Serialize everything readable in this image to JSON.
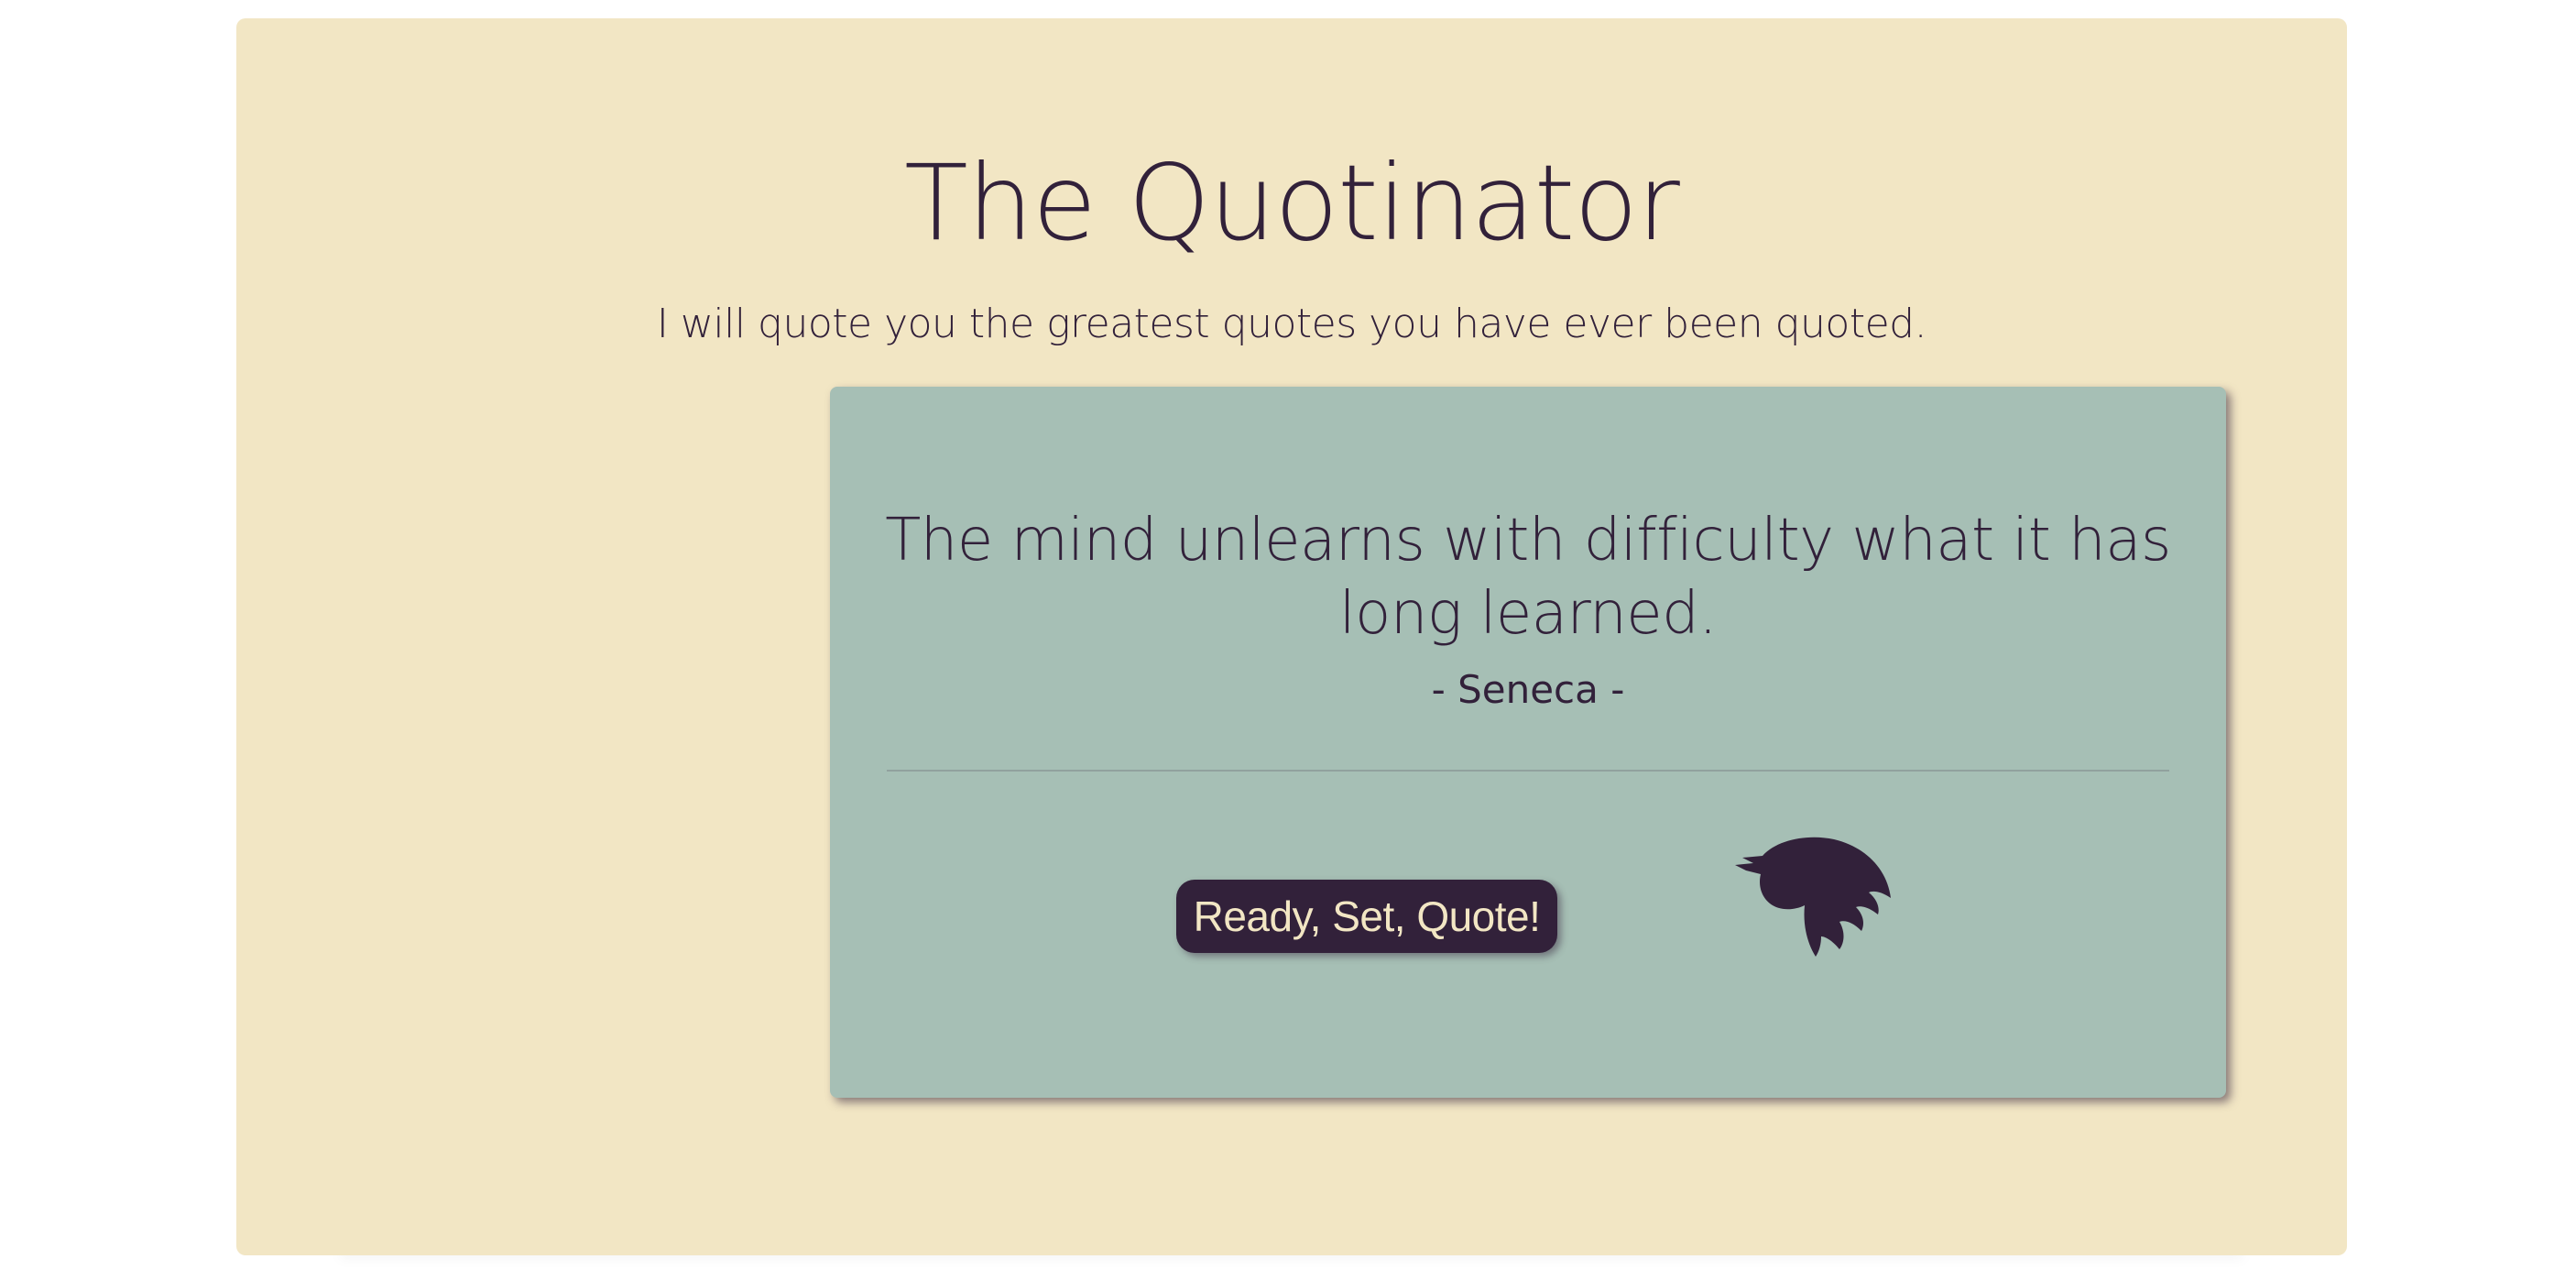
{
  "header": {
    "title": "The Quotinator",
    "subtitle": "I will quote you the greatest quotes you have ever been quoted."
  },
  "quote": {
    "text": "The mind unlearns with difficulty what it has long learned.",
    "author": "- Seneca -"
  },
  "actions": {
    "new_quote_label": "Ready, Set, Quote!",
    "tweet_icon": "twitter-bird-icon"
  },
  "colors": {
    "page_background": "#f2e6c4",
    "card_background": "#a6bfb5",
    "text": "#32213a",
    "button_background": "#32213a",
    "button_text": "#f2e6c4"
  }
}
